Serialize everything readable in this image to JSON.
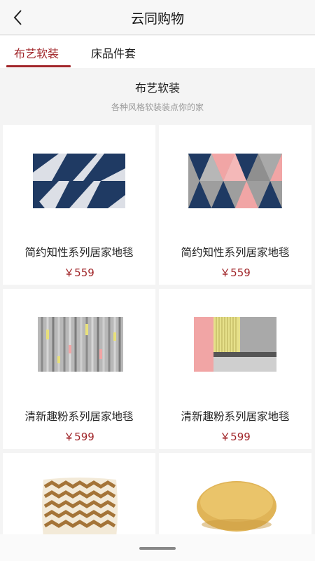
{
  "header": {
    "title": "云同购物",
    "back_icon": "chevron-left-icon"
  },
  "tabs": [
    {
      "label": "布艺软装",
      "active": true
    },
    {
      "label": "床品件套",
      "active": false
    }
  ],
  "section": {
    "title": "布艺软装",
    "subtitle": "各种风格软装装点你的家"
  },
  "products": [
    {
      "name": "简约知性系列居家地毯",
      "price": "￥559",
      "image": "navy-white-triangle-rug"
    },
    {
      "name": "简约知性系列居家地毯",
      "price": "￥559",
      "image": "navy-pink-grey-triangle-rug"
    },
    {
      "name": "清新趣粉系列居家地毯",
      "price": "￥599",
      "image": "grey-striped-rug"
    },
    {
      "name": "清新趣粉系列居家地毯",
      "price": "￥599",
      "image": "pink-grey-block-rug"
    },
    {
      "name": "",
      "price": "",
      "image": "chevron-throw-pillow"
    },
    {
      "name": "",
      "price": "",
      "image": "round-yellow-cushion"
    }
  ],
  "colors": {
    "accent": "#a1262a",
    "navy": "#1f3a63",
    "pink": "#f1a5a5",
    "grey": "#9e9e9e"
  }
}
